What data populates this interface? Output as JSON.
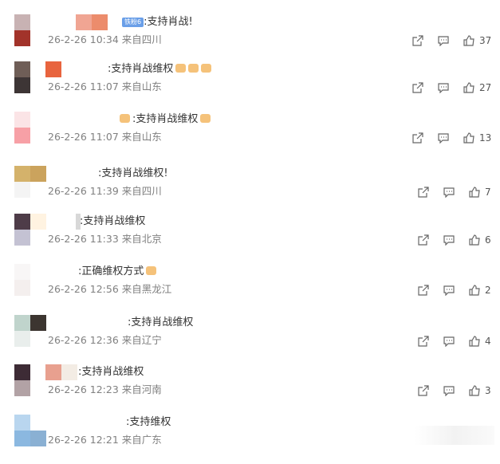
{
  "comments": [
    {
      "text": ":支持肖战!",
      "badge": "铁粉6",
      "date": "26-2-26 10:34",
      "location": "来自四川",
      "likes": "37",
      "thumbs": 0
    },
    {
      "text": ":支持肖战维权",
      "date": "26-2-26 11:07",
      "location": "来自山东",
      "likes": "27",
      "thumbs": 3
    },
    {
      "text": ":支持肖战维权",
      "date": "26-2-26 11:07",
      "location": "来自山东",
      "likes": "13",
      "thumbs": 1
    },
    {
      "text": ":支持肖战维权!",
      "date": "26-2-26 11:39",
      "location": "来自四川",
      "likes": "7",
      "thumbs": 0
    },
    {
      "text": ":支持肖战维权",
      "date": "26-2-26 11:33",
      "location": "来自北京",
      "likes": "6",
      "thumbs": 0
    },
    {
      "text": ":正确维权方式",
      "date": "26-2-26 12:56",
      "location": "来自黑龙江",
      "likes": "2",
      "thumbs": 1
    },
    {
      "text": ":支持肖战维权",
      "date": "26-2-26 12:36",
      "location": "来自辽宁",
      "likes": "4",
      "thumbs": 0
    },
    {
      "text": ":支持肖战维权",
      "date": "26-2-26 12:23",
      "location": "来自河南",
      "likes": "3",
      "thumbs": 0
    },
    {
      "text": ":支持维权",
      "date": "26-2-26 12:21",
      "location": "来自广东",
      "likes": "",
      "thumbs": 0
    }
  ],
  "icons": {
    "share": "share-icon",
    "comment": "comment-icon",
    "like": "thumbs-up-icon"
  }
}
